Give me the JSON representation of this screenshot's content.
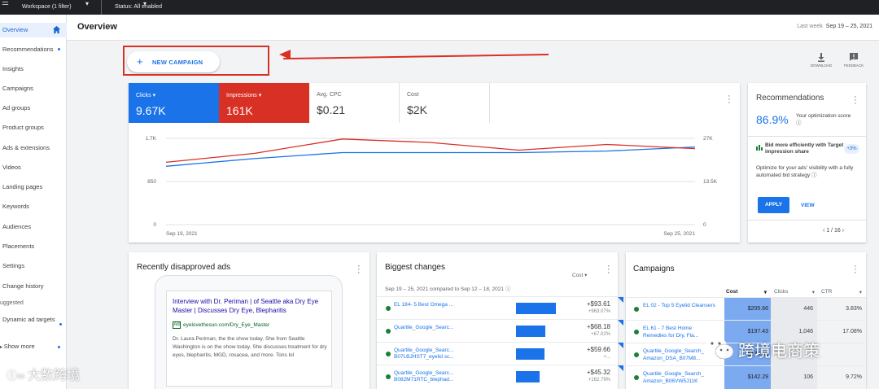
{
  "topbar": {
    "workspace": "Workspace (1 filter)",
    "status": "Status: All enabled"
  },
  "sidebar": {
    "items": [
      {
        "label": "Overview"
      },
      {
        "label": "Recommendations"
      },
      {
        "label": "Insights"
      },
      {
        "label": "Campaigns"
      },
      {
        "label": "Ad groups"
      },
      {
        "label": "Product groups"
      },
      {
        "label": "Ads & extensions"
      },
      {
        "label": "Videos"
      },
      {
        "label": "Landing pages"
      },
      {
        "label": "Keywords"
      },
      {
        "label": "Audiences"
      },
      {
        "label": "Placements"
      },
      {
        "label": "Settings"
      },
      {
        "label": "Change history"
      }
    ],
    "section_label": "uggested",
    "dynamic_ad": "Dynamic ad targets",
    "show_more": "Show more"
  },
  "header": {
    "title": "Overview",
    "date_prefix": "Last week",
    "date_range": "Sep 19 – 25, 2021"
  },
  "new_campaign": {
    "label": "NEW CAMPAIGN",
    "plus": "+"
  },
  "tools": {
    "download": "DOWNLOAD",
    "feedback": "FEEDBACK"
  },
  "metrics": [
    {
      "label": "Clicks",
      "value": "9.67K"
    },
    {
      "label": "Impressions",
      "value": "161K"
    },
    {
      "label": "Avg. CPC",
      "value": "$0.21"
    },
    {
      "label": "Cost",
      "value": "$2K"
    }
  ],
  "chart_data": {
    "type": "line",
    "x": [
      "Sep 19, 2021",
      "Sep 20, 2021",
      "Sep 21, 2021",
      "Sep 22, 2021",
      "Sep 23, 2021",
      "Sep 24, 2021",
      "Sep 25, 2021"
    ],
    "x_tick_labels": [
      "Sep 19, 2021",
      "Sep 25, 2021"
    ],
    "y_left_ticks": [
      "1.7K",
      "850",
      "0"
    ],
    "y_right_ticks": [
      "27K",
      "13.5K",
      "0"
    ],
    "ylim_left": [
      0,
      1700
    ],
    "ylim_right": [
      0,
      27000
    ],
    "series": [
      {
        "name": "Clicks",
        "axis": "left",
        "color": "#1a73e8",
        "values": [
          1150,
          1300,
          1420,
          1420,
          1420,
          1450,
          1530
        ]
      },
      {
        "name": "Impressions",
        "axis": "right",
        "color": "#d93025",
        "values": [
          19500,
          22300,
          26800,
          25700,
          23300,
          25100,
          23800
        ]
      }
    ],
    "grid": true
  },
  "recommendations": {
    "title": "Recommendations",
    "score": "86.9%",
    "score_label": "Your optimization score",
    "tip": "Bid more efficiently with Target impression share",
    "badge": "+3%",
    "desc": "Optimize for your ads' visibility with a fully automated bid strategy",
    "apply": "APPLY",
    "view": "VIEW",
    "pager": "1 / 16"
  },
  "disapproved": {
    "title": "Recently disapproved ads",
    "headline": "Interview with Dr. Periman | of Seattle aka Dry Eye Master | Discusses Dry Eye, Blepharitis",
    "ad_tag": "Ad",
    "url": "eyelovethesun.com/Dry_Eye_Master",
    "body": "Dr. Laura Periman, the the show today. She from Seattle Washington is on the show today. She discusses treatment for dry eyes, blepharitis, MGD, rosacea, and more. Tons lol"
  },
  "biggest_changes": {
    "title": "Biggest changes",
    "subtitle": "Sep 19 – 25, 2021 compared to Sep 12 – 18, 2021",
    "metric": "Cost",
    "rows": [
      {
        "name": "EL 184- 5 Best Omega ...",
        "value": "+$93.61",
        "pct": "+963.07%",
        "bar": 0.95
      },
      {
        "name": "Quartile_Google_Searc...",
        "value": "+$68.18",
        "pct": "+67.02%",
        "bar": 0.7
      },
      {
        "name": "Quartile_Google_Searc... B07LBJHST7_eyelid sc...",
        "value": "+$59.66",
        "pct": "+...",
        "bar": 0.68
      },
      {
        "name": "Quartile_Google_Searc... B082M71RTC_blephad...",
        "value": "+$45.32",
        "pct": "+162.79%",
        "bar": 0.55
      }
    ]
  },
  "campaigns": {
    "title": "Campaigns",
    "columns": [
      "Cost",
      "Clicks",
      "CTR"
    ],
    "rows": [
      {
        "name": "EL 02 - Top 5 Eyelid Cleansers",
        "cost": "$205.66",
        "clicks": "446",
        "ctr": "3.83%"
      },
      {
        "name": "EL 61 - 7 Best Home Remedies for Dry, Fla...",
        "cost": "$197.43",
        "clicks": "1,046",
        "ctr": "17.08%"
      },
      {
        "name": "Quartile_Google_Search_ Amazon_DSA_B07M8...",
        "cost": "$174.99",
        "clicks": "",
        "ctr": ""
      },
      {
        "name": "Quartile_Google_Search_ Amazon_B06VW5J11K",
        "cost": "$142.29",
        "clicks": "106",
        "ctr": "9.72%"
      }
    ]
  },
  "watermarks": {
    "left": "大数跨境",
    "right": "跨境电商策"
  }
}
